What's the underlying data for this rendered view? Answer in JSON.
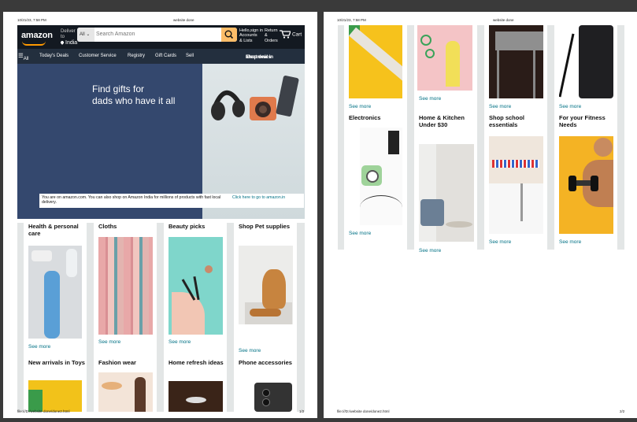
{
  "print": {
    "date": "10/21/23, 7:58 PM",
    "doc_title": "website done",
    "path": "file:///D:/website done/done2.html",
    "page1_num": "1/2",
    "page2_num": "2/2"
  },
  "header": {
    "logo": "amazon",
    "deliver_line1": "Deliver",
    "deliver_line2": "to",
    "deliver_country": "India",
    "search_category": "All",
    "search_placeholder": "Search Amazon",
    "account_line1": "Hello,sign in",
    "account_line2": "Accounts",
    "account_line3": "& Lists",
    "returns_line1": "Return",
    "returns_line2": "&",
    "returns_line3": "Orders",
    "cart": "Cart"
  },
  "nav": {
    "all": "All",
    "items": [
      "Today's Deals",
      "Customer Service",
      "Registry",
      "Gift Cards",
      "Sell"
    ],
    "promo_line1": "shop deal in",
    "promo_line2": "Electronics"
  },
  "hero": {
    "title_line1": "Find gifts for",
    "title_line2": "dads who have it all",
    "notice": "You are on amazon.com. You can also shop on Amazon India for millions of products with fast local delivery.",
    "notice_link": "Click here to go to amazon.in"
  },
  "cards_page1_row1": [
    {
      "title": "Health & personal care",
      "more": "See more"
    },
    {
      "title": "Cloths",
      "more": "See more"
    },
    {
      "title": "Beauty picks",
      "more": "See more"
    },
    {
      "title": "Shop Pet supplies",
      "more": "See more"
    }
  ],
  "cards_page1_row2": [
    {
      "title": "New arrivals in Toys"
    },
    {
      "title": "Fashion wear"
    },
    {
      "title": "Home refresh ideas"
    },
    {
      "title": "Phone accessories"
    }
  ],
  "cards_page2_top": [
    {
      "more": "See more"
    },
    {
      "more": "See more"
    },
    {
      "more": "See more"
    },
    {
      "more": "See more"
    }
  ],
  "cards_page2_bottom": [
    {
      "title": "Electronics",
      "more": "See more"
    },
    {
      "title": "Home & Kitchen Under $30",
      "more": "See more"
    },
    {
      "title": "Shop school essentials",
      "more": "See more"
    },
    {
      "title": "For your Fitness Needs",
      "more": "See more"
    }
  ],
  "colors": {
    "nav_dark": "#131921",
    "nav_sub": "#232f3e",
    "accent": "#ff9900",
    "search_button": "#febd69",
    "hero_blue": "#34486e",
    "link": "#007185"
  }
}
